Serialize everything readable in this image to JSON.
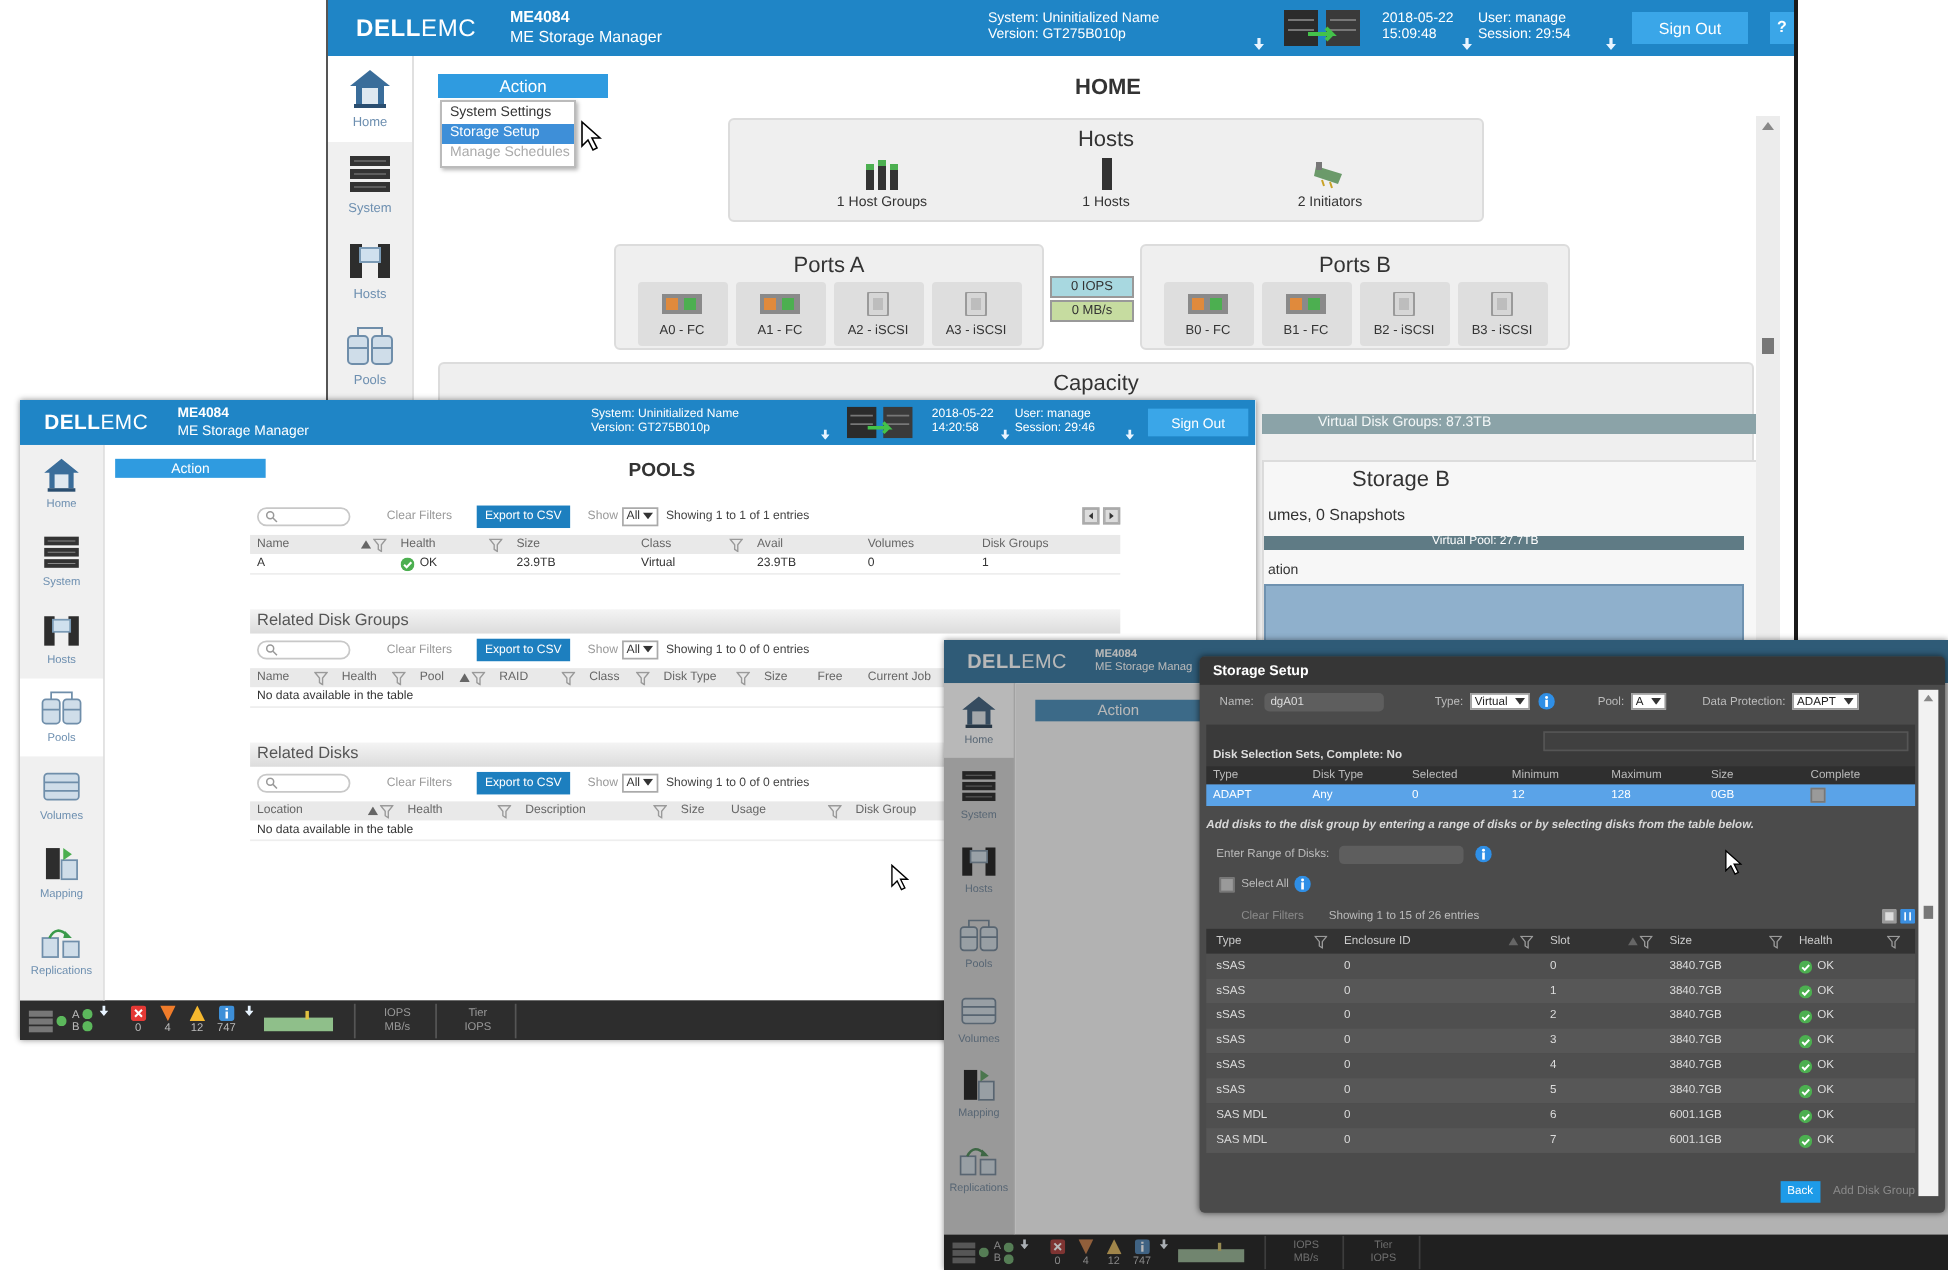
{
  "home_window": {
    "header": {
      "logo": "**DELL**EMC",
      "product": "ME4084",
      "subtitle": "ME Storage Manager",
      "system": "System: Uninitialized Name",
      "version": "Version: GT275B010p",
      "date": "2018-05-22",
      "time": "15:09:48",
      "user": "User: manage",
      "session": "Session: 29:54",
      "sign_out": "Sign Out",
      "help": "?"
    },
    "sidebar": [
      {
        "label": "Home",
        "selected": true
      },
      {
        "label": "System",
        "selected": false
      },
      {
        "label": "Hosts",
        "selected": false
      },
      {
        "label": "Pools",
        "selected": false
      }
    ],
    "action": "Action",
    "action_menu": [
      {
        "label": "System Settings",
        "selected": false,
        "disabled": false
      },
      {
        "label": "Storage Setup",
        "selected": true,
        "disabled": false
      },
      {
        "label": "Manage Schedules",
        "selected": false,
        "disabled": true
      }
    ],
    "title": "HOME",
    "hosts": {
      "title": "Hosts",
      "items": [
        {
          "kind": "host-group",
          "label": "1 Host Groups"
        },
        {
          "kind": "host",
          "label": "1 Hosts"
        },
        {
          "kind": "initiator",
          "label": "2 Initiators"
        }
      ]
    },
    "ports": [
      {
        "title": "Ports A",
        "ports": [
          {
            "label": "A0 - FC",
            "kind": "fc"
          },
          {
            "label": "A1 - FC",
            "kind": "fc"
          },
          {
            "label": "A2 - iSCSI",
            "kind": "iscsi"
          },
          {
            "label": "A3 - iSCSI",
            "kind": "iscsi"
          }
        ]
      },
      {
        "title": "Ports B",
        "ports": [
          {
            "label": "B0 - FC",
            "kind": "fc"
          },
          {
            "label": "B1 - FC",
            "kind": "fc"
          },
          {
            "label": "B2 - iSCSI",
            "kind": "iscsi"
          },
          {
            "label": "B3 - iSCSI",
            "kind": "iscsi"
          }
        ]
      }
    ],
    "throughput": [
      "0 IOPS",
      "0 MB/s"
    ],
    "capacity": {
      "title": "Capacity",
      "bar_label": "Virtual Disk Groups: 87.3TB"
    },
    "storage_b": {
      "title": "Storage B",
      "summary": "umes, 0 Snapshots",
      "bar_label": "Virtual Pool: 27.7TB",
      "legend": "ation"
    }
  },
  "pools_window": {
    "header": {
      "logo": "**DELL**EMC",
      "product": "ME4084",
      "subtitle": "ME Storage Manager",
      "system": "System: Uninitialized Name",
      "version": "Version: GT275B010p",
      "date": "2018-05-22",
      "time": "14:20:58",
      "user": "User: manage",
      "session": "Session: 29:46",
      "sign_out": "Sign Out"
    },
    "sidebar": [
      {
        "label": "Home",
        "selected": false
      },
      {
        "label": "System",
        "selected": false
      },
      {
        "label": "Hosts",
        "selected": false
      },
      {
        "label": "Pools",
        "selected": true
      },
      {
        "label": "Volumes",
        "selected": false
      },
      {
        "label": "Mapping",
        "selected": false
      },
      {
        "label": "Replications",
        "selected": false
      }
    ],
    "action": "Action",
    "title": "POOLS",
    "tables": [
      {
        "toolbar": {
          "clear_filters": "Clear Filters",
          "export": "Export to CSV",
          "show_label": "Show",
          "show_value": "All",
          "showing": "Showing 1 to 1 of 1 entries"
        },
        "columns": [
          {
            "label": "Name",
            "kind": "text",
            "sorted": true,
            "filter": true
          },
          {
            "label": "Health",
            "kind": "health",
            "sorted": false,
            "filter": true
          },
          {
            "label": "Size",
            "kind": "text",
            "sorted": false,
            "filter": false
          },
          {
            "label": "Class",
            "kind": "text",
            "sorted": false,
            "filter": true
          },
          {
            "label": "Avail",
            "kind": "text",
            "sorted": false,
            "filter": false
          },
          {
            "label": "Volumes",
            "kind": "text",
            "sorted": false,
            "filter": false
          },
          {
            "label": "Disk Groups",
            "kind": "text",
            "sorted": false,
            "filter": false
          }
        ],
        "rows": [
          [
            "A",
            "OK",
            "23.9TB",
            "Virtual",
            "23.9TB",
            "0",
            "1"
          ]
        ]
      },
      {
        "title": "Related Disk Groups",
        "toolbar": {
          "clear_filters": "Clear Filters",
          "export": "Export to CSV",
          "show_label": "Show",
          "show_value": "All",
          "showing": "Showing 1 to 0 of 0 entries"
        },
        "columns": [
          {
            "label": "Name",
            "sorted": false,
            "filter": true
          },
          {
            "label": "Health",
            "sorted": false,
            "filter": true
          },
          {
            "label": "Pool",
            "sorted": true,
            "filter": true
          },
          {
            "label": "RAID",
            "sorted": false,
            "filter": true
          },
          {
            "label": "Class",
            "sorted": false,
            "filter": true
          },
          {
            "label": "Disk Type",
            "sorted": false,
            "filter": true
          },
          {
            "label": "Size",
            "sorted": false,
            "filter": false
          },
          {
            "label": "Free",
            "sorted": false,
            "filter": false
          },
          {
            "label": "Current Job",
            "sorted": false,
            "filter": false
          }
        ],
        "empty": "No data available in the table"
      },
      {
        "title": "Related Disks",
        "toolbar": {
          "clear_filters": "Clear Filters",
          "export": "Export to CSV",
          "show_label": "Show",
          "show_value": "All",
          "showing": "Showing 1 to 0 of 0 entries"
        },
        "columns": [
          {
            "label": "Location",
            "sorted": true,
            "filter": true
          },
          {
            "label": "Health",
            "sorted": false,
            "filter": true
          },
          {
            "label": "Description",
            "sorted": false,
            "filter": true
          },
          {
            "label": "Size",
            "sorted": false,
            "filter": false
          },
          {
            "label": "Usage",
            "sorted": false,
            "filter": true
          },
          {
            "label": "Disk Group",
            "sorted": false,
            "filter": false
          }
        ],
        "empty": "No data available in the table"
      }
    ],
    "status": {
      "controllers": [
        "A",
        "B"
      ],
      "alerts": [
        {
          "kind": "critical",
          "count": "0"
        },
        {
          "kind": "error",
          "count": "4"
        },
        {
          "kind": "warning",
          "count": "12"
        },
        {
          "kind": "info",
          "count": "747"
        }
      ],
      "io": [
        "IOPS",
        "MB/s"
      ],
      "tier": [
        "Tier",
        "IOPS"
      ]
    }
  },
  "setup_window": {
    "header": {
      "logo": "**DELL**EMC",
      "product": "ME4084",
      "subtitle": "ME Storage Manag"
    },
    "sidebar": [
      {
        "label": "Home",
        "selected": true
      },
      {
        "label": "System",
        "selected": false
      },
      {
        "label": "Hosts",
        "selected": false
      },
      {
        "label": "Pools",
        "selected": false
      },
      {
        "label": "Volumes",
        "selected": false
      },
      {
        "label": "Mapping",
        "selected": false
      },
      {
        "label": "Replications",
        "selected": false
      }
    ],
    "action": "Action",
    "status": {
      "controllers": [
        "A",
        "B"
      ],
      "alerts": [
        {
          "kind": "critical",
          "count": "0"
        },
        {
          "kind": "error",
          "count": "4"
        },
        {
          "kind": "warning",
          "count": "12"
        },
        {
          "kind": "info",
          "count": "747"
        }
      ],
      "io": [
        "IOPS",
        "MB/s"
      ],
      "tier": [
        "Tier",
        "IOPS"
      ]
    },
    "dialog": {
      "title": "Storage Setup",
      "name_label": "Name:",
      "name_value": "dgA01",
      "type_label": "Type:",
      "type_value": "Virtual",
      "pool_label": "Pool:",
      "pool_value": "A",
      "protection_label": "Data Protection:",
      "protection_value": "ADAPT",
      "sets_title": "Disk Selection Sets, Complete: No",
      "sets_columns": [
        "Type",
        "Disk Type",
        "Selected",
        "Minimum",
        "Maximum",
        "Size",
        "Complete"
      ],
      "sets_rows": [
        {
          "cells": [
            "ADAPT",
            "Any",
            "0",
            "12",
            "128",
            "0GB"
          ],
          "complete": false,
          "selected": true
        }
      ],
      "hint": "Add disks to the disk group by entering a range of disks or by selecting disks from the table below.",
      "range_label": "Enter Range of Disks:",
      "select_all": {
        "label": "Select All",
        "checked": false
      },
      "clear_filters": "Clear Filters",
      "showing": "Showing 1 to 15 of 26 entries",
      "disk_columns": [
        {
          "label": "Type",
          "kind": "text",
          "sorted": false,
          "filter": true
        },
        {
          "label": "Enclosure ID",
          "kind": "text",
          "sorted": true,
          "filter": true
        },
        {
          "label": "Slot",
          "kind": "text",
          "sorted": true,
          "filter": true
        },
        {
          "label": "Size",
          "kind": "text",
          "sorted": false,
          "filter": true
        },
        {
          "label": "Health",
          "kind": "health",
          "sorted": false,
          "filter": true
        }
      ],
      "disks": [
        {
          "cells": [
            "sSAS",
            "0",
            "0",
            "3840.7GB",
            "OK"
          ],
          "selected": false
        },
        {
          "cells": [
            "sSAS",
            "0",
            "1",
            "3840.7GB",
            "OK"
          ],
          "selected": false
        },
        {
          "cells": [
            "sSAS",
            "0",
            "2",
            "3840.7GB",
            "OK"
          ],
          "selected": false
        },
        {
          "cells": [
            "sSAS",
            "0",
            "3",
            "3840.7GB",
            "OK"
          ],
          "selected": false
        },
        {
          "cells": [
            "sSAS",
            "0",
            "4",
            "3840.7GB",
            "OK"
          ],
          "selected": false
        },
        {
          "cells": [
            "sSAS",
            "0",
            "5",
            "3840.7GB",
            "OK"
          ],
          "selected": false
        },
        {
          "cells": [
            "SAS MDL",
            "0",
            "6",
            "6001.1GB",
            "OK"
          ],
          "selected": false
        },
        {
          "cells": [
            "SAS MDL",
            "0",
            "7",
            "6001.1GB",
            "OK"
          ],
          "selected": false
        }
      ],
      "back": "Back",
      "add": "Add Disk Group",
      "add_disabled": true
    }
  }
}
